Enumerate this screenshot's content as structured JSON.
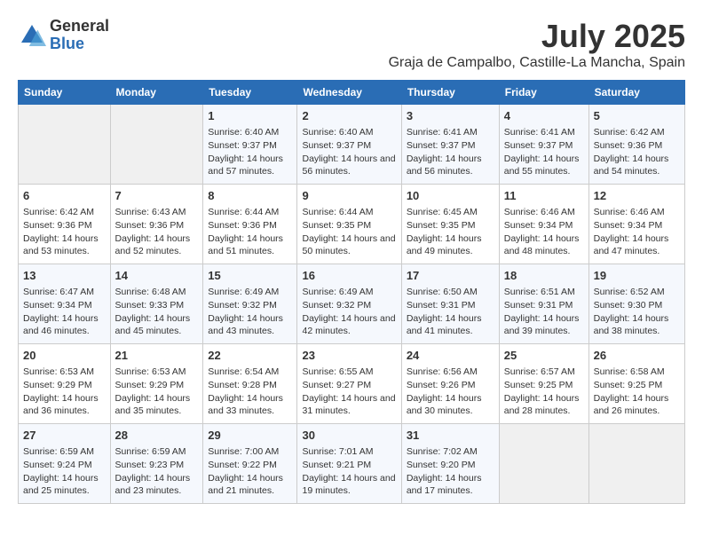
{
  "logo": {
    "general": "General",
    "blue": "Blue"
  },
  "title": "July 2025",
  "subtitle": "Graja de Campalbo, Castille-La Mancha, Spain",
  "days_of_week": [
    "Sunday",
    "Monday",
    "Tuesday",
    "Wednesday",
    "Thursday",
    "Friday",
    "Saturday"
  ],
  "weeks": [
    [
      {
        "day": "",
        "sunrise": "",
        "sunset": "",
        "daylight": ""
      },
      {
        "day": "",
        "sunrise": "",
        "sunset": "",
        "daylight": ""
      },
      {
        "day": "1",
        "sunrise": "Sunrise: 6:40 AM",
        "sunset": "Sunset: 9:37 PM",
        "daylight": "Daylight: 14 hours and 57 minutes."
      },
      {
        "day": "2",
        "sunrise": "Sunrise: 6:40 AM",
        "sunset": "Sunset: 9:37 PM",
        "daylight": "Daylight: 14 hours and 56 minutes."
      },
      {
        "day": "3",
        "sunrise": "Sunrise: 6:41 AM",
        "sunset": "Sunset: 9:37 PM",
        "daylight": "Daylight: 14 hours and 56 minutes."
      },
      {
        "day": "4",
        "sunrise": "Sunrise: 6:41 AM",
        "sunset": "Sunset: 9:37 PM",
        "daylight": "Daylight: 14 hours and 55 minutes."
      },
      {
        "day": "5",
        "sunrise": "Sunrise: 6:42 AM",
        "sunset": "Sunset: 9:36 PM",
        "daylight": "Daylight: 14 hours and 54 minutes."
      }
    ],
    [
      {
        "day": "6",
        "sunrise": "Sunrise: 6:42 AM",
        "sunset": "Sunset: 9:36 PM",
        "daylight": "Daylight: 14 hours and 53 minutes."
      },
      {
        "day": "7",
        "sunrise": "Sunrise: 6:43 AM",
        "sunset": "Sunset: 9:36 PM",
        "daylight": "Daylight: 14 hours and 52 minutes."
      },
      {
        "day": "8",
        "sunrise": "Sunrise: 6:44 AM",
        "sunset": "Sunset: 9:36 PM",
        "daylight": "Daylight: 14 hours and 51 minutes."
      },
      {
        "day": "9",
        "sunrise": "Sunrise: 6:44 AM",
        "sunset": "Sunset: 9:35 PM",
        "daylight": "Daylight: 14 hours and 50 minutes."
      },
      {
        "day": "10",
        "sunrise": "Sunrise: 6:45 AM",
        "sunset": "Sunset: 9:35 PM",
        "daylight": "Daylight: 14 hours and 49 minutes."
      },
      {
        "day": "11",
        "sunrise": "Sunrise: 6:46 AM",
        "sunset": "Sunset: 9:34 PM",
        "daylight": "Daylight: 14 hours and 48 minutes."
      },
      {
        "day": "12",
        "sunrise": "Sunrise: 6:46 AM",
        "sunset": "Sunset: 9:34 PM",
        "daylight": "Daylight: 14 hours and 47 minutes."
      }
    ],
    [
      {
        "day": "13",
        "sunrise": "Sunrise: 6:47 AM",
        "sunset": "Sunset: 9:34 PM",
        "daylight": "Daylight: 14 hours and 46 minutes."
      },
      {
        "day": "14",
        "sunrise": "Sunrise: 6:48 AM",
        "sunset": "Sunset: 9:33 PM",
        "daylight": "Daylight: 14 hours and 45 minutes."
      },
      {
        "day": "15",
        "sunrise": "Sunrise: 6:49 AM",
        "sunset": "Sunset: 9:32 PM",
        "daylight": "Daylight: 14 hours and 43 minutes."
      },
      {
        "day": "16",
        "sunrise": "Sunrise: 6:49 AM",
        "sunset": "Sunset: 9:32 PM",
        "daylight": "Daylight: 14 hours and 42 minutes."
      },
      {
        "day": "17",
        "sunrise": "Sunrise: 6:50 AM",
        "sunset": "Sunset: 9:31 PM",
        "daylight": "Daylight: 14 hours and 41 minutes."
      },
      {
        "day": "18",
        "sunrise": "Sunrise: 6:51 AM",
        "sunset": "Sunset: 9:31 PM",
        "daylight": "Daylight: 14 hours and 39 minutes."
      },
      {
        "day": "19",
        "sunrise": "Sunrise: 6:52 AM",
        "sunset": "Sunset: 9:30 PM",
        "daylight": "Daylight: 14 hours and 38 minutes."
      }
    ],
    [
      {
        "day": "20",
        "sunrise": "Sunrise: 6:53 AM",
        "sunset": "Sunset: 9:29 PM",
        "daylight": "Daylight: 14 hours and 36 minutes."
      },
      {
        "day": "21",
        "sunrise": "Sunrise: 6:53 AM",
        "sunset": "Sunset: 9:29 PM",
        "daylight": "Daylight: 14 hours and 35 minutes."
      },
      {
        "day": "22",
        "sunrise": "Sunrise: 6:54 AM",
        "sunset": "Sunset: 9:28 PM",
        "daylight": "Daylight: 14 hours and 33 minutes."
      },
      {
        "day": "23",
        "sunrise": "Sunrise: 6:55 AM",
        "sunset": "Sunset: 9:27 PM",
        "daylight": "Daylight: 14 hours and 31 minutes."
      },
      {
        "day": "24",
        "sunrise": "Sunrise: 6:56 AM",
        "sunset": "Sunset: 9:26 PM",
        "daylight": "Daylight: 14 hours and 30 minutes."
      },
      {
        "day": "25",
        "sunrise": "Sunrise: 6:57 AM",
        "sunset": "Sunset: 9:25 PM",
        "daylight": "Daylight: 14 hours and 28 minutes."
      },
      {
        "day": "26",
        "sunrise": "Sunrise: 6:58 AM",
        "sunset": "Sunset: 9:25 PM",
        "daylight": "Daylight: 14 hours and 26 minutes."
      }
    ],
    [
      {
        "day": "27",
        "sunrise": "Sunrise: 6:59 AM",
        "sunset": "Sunset: 9:24 PM",
        "daylight": "Daylight: 14 hours and 25 minutes."
      },
      {
        "day": "28",
        "sunrise": "Sunrise: 6:59 AM",
        "sunset": "Sunset: 9:23 PM",
        "daylight": "Daylight: 14 hours and 23 minutes."
      },
      {
        "day": "29",
        "sunrise": "Sunrise: 7:00 AM",
        "sunset": "Sunset: 9:22 PM",
        "daylight": "Daylight: 14 hours and 21 minutes."
      },
      {
        "day": "30",
        "sunrise": "Sunrise: 7:01 AM",
        "sunset": "Sunset: 9:21 PM",
        "daylight": "Daylight: 14 hours and 19 minutes."
      },
      {
        "day": "31",
        "sunrise": "Sunrise: 7:02 AM",
        "sunset": "Sunset: 9:20 PM",
        "daylight": "Daylight: 14 hours and 17 minutes."
      },
      {
        "day": "",
        "sunrise": "",
        "sunset": "",
        "daylight": ""
      },
      {
        "day": "",
        "sunrise": "",
        "sunset": "",
        "daylight": ""
      }
    ]
  ]
}
